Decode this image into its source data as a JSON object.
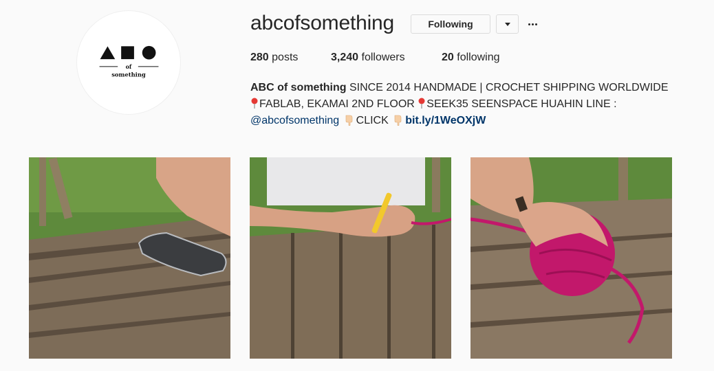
{
  "profile": {
    "username": "abcofsomething",
    "avatar_logo_text_1": "of",
    "avatar_logo_text_2": "something"
  },
  "actions": {
    "following_label": "Following",
    "dropdown_icon": "chevron-down-icon",
    "more_icon": "more-options-icon"
  },
  "stats": {
    "posts_count": "280",
    "posts_label": "posts",
    "followers_count": "3,240",
    "followers_label": "followers",
    "following_count": "20",
    "following_label": "following"
  },
  "bio": {
    "name": "ABC of something",
    "line1_text": "SINCE 2014 HANDMADE | CROCHET SHIPPING WORLDWIDE",
    "line2_part1": "FABLAB, EKAMAI 2ND FLOOR",
    "line2_part2": "SEEK35 SEENSPACE HUAHIN LINE :",
    "mention": "@abcofsomething",
    "click_text": "CLICK",
    "link": "bit.ly/1WeOXjW"
  },
  "colors": {
    "background": "#fafafa",
    "text": "#262626",
    "link": "#003569",
    "yarn": "#c2186b"
  },
  "posts": [
    {
      "subject": "arm-and-phone-on-wooden-table"
    },
    {
      "subject": "hand-holding-crochet-hook"
    },
    {
      "subject": "hand-holding-pink-yarn-ball"
    }
  ]
}
